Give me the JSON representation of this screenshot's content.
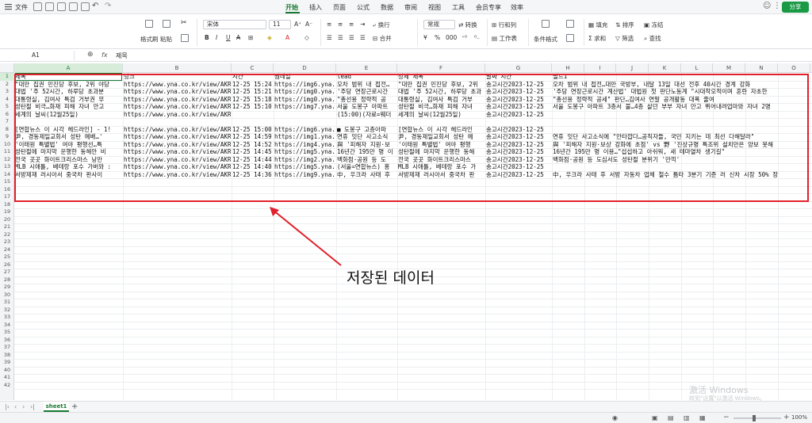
{
  "titlebar": {
    "file_menu": "文件",
    "tabs": [
      "开始",
      "插入",
      "页面",
      "公式",
      "数据",
      "审阅",
      "视图",
      "工具",
      "会员专享",
      "效率"
    ],
    "active_tab": "开始",
    "share_label": "分享"
  },
  "ribbon": {
    "format_painter": "格式刷",
    "paste": "粘贴",
    "font_name": "宋体",
    "font_size": "11",
    "number_format": "常规",
    "convert": "转换",
    "wrap": "换行",
    "merge": "合并",
    "rows_cols": "行和列",
    "worksheet": "工作表",
    "conditional_format": "条件格式",
    "fill": "填充",
    "sort": "排序",
    "freeze": "冻结",
    "sum": "求和",
    "filter": "筛选",
    "find": "查找"
  },
  "formula_bar": {
    "cell_ref": "A1",
    "fx": "fx",
    "value": "제목"
  },
  "columns": [
    "A",
    "B",
    "C",
    "D",
    "E",
    "F",
    "G",
    "H",
    "I",
    "J",
    "K",
    "L",
    "M",
    "N",
    "O"
  ],
  "rows": [
    {
      "n": "1",
      "cells": [
        "제목",
        "링크",
        "시간",
        "썸네일",
        "lead",
        "상세 제목",
        "날짜 시간",
        "필드1"
      ]
    },
    {
      "n": "2",
      "cells": [
        "\"대만 집권 민진당 후보, 2위 야당",
        "https://www.yna.co.kr/view/AKR2C",
        "12-25 15:24",
        "https://img6.yna.c",
        "오차 범위 내 접전…",
        "\"대만 집권 민진당 후보, 2위",
        "송고시간2023-12-25",
        "오차 범위 내 접전…대만 국방부, 내달 13일 대선 전후 40시간 경계 강화"
      ]
    },
    {
      "n": "3",
      "cells": [
        "대법 '주 52시간, 하루당 초과분",
        "https://www.yna.co.kr/view/AKR2C",
        "12-25 15:21",
        "https://img0.yna.c",
        "'주당 연장근로시간",
        "대법 '주 52시간, 하루당 초과",
        "송고시간2023-12-25",
        "'주당 연장근로시간 계산법' 대법원 첫 판단노동계 \"시대착오적이며 혼란 자초한"
      ]
    },
    {
      "n": "4",
      "cells": [
        "대통령실, 김여사 특검 거부권 무",
        "https://www.yna.co.kr/view/AKR2C",
        "12-25 15:18",
        "https://img0.yna.c",
        "\"총선용 정략적 공",
        "대통령실, 김여사 특검 거부",
        "송고시간2023-12-25",
        "\"총선용 정략적 공세\" 판단…김여사 연말 공개활동 대폭 줄여"
      ]
    },
    {
      "n": "5",
      "cells": [
        "성탄절 비극…화재 피해 자녀 안고",
        "https://www.yna.co.kr/view/AKR2C",
        "12-25 15:10",
        "https://img7.yna.c",
        "서울 도봉구 아파트",
        "성탄절 비극…화재 피해 자녀",
        "송고시간2023-12-25",
        "서울 도봉구 아파트 3층서 불…4층 살던 부부 자녀 안고 뛰어내려업마와 자녀 2명"
      ]
    },
    {
      "n": "6",
      "cells": [
        "세계의 날씨(12월25일)",
        "https://www.yna.co.kr/view/AKR2C",
        "",
        "",
        "(15:00)(자료=웨더",
        "세계의 날씨(12월25일)",
        "송고시간2023-12-25",
        ""
      ]
    },
    {
      "n": "7",
      "cells": [
        "",
        "",
        "",
        "",
        "",
        "",
        "",
        ""
      ]
    },
    {
      "n": "8",
      "cells": [
        "[연합뉴스 이 시각 헤드라인] - 1!",
        "https://www.yna.co.kr/view/AKR2C",
        "12-25 15:00",
        "https://img6.yna.c",
        "■ 도봉구 고층아파",
        "[연합뉴스 이 시각 헤드라인",
        "송고시간2023-12-25",
        ""
      ]
    },
    {
      "n": "9",
      "cells": [
        "尹, 경동제일교회서 성탄 예배…'",
        "https://www.yna.co.kr/view/AKR2C",
        "12-25 14:59",
        "https://img1.yna.c",
        "연휴 잇단 사고소식",
        "尹, 경동제일교회서 성탄 예",
        "송고시간2023-12-25",
        "연휴 잇단 사고소식에 \"안타깝다…공직자들, 국민 지키는 데 최선 다해달라\""
      ]
    },
    {
      "n": "10",
      "cells": [
        "'이태원 특별법' 여야 평행선…특",
        "https://www.yna.co.kr/view/AKR2C",
        "12-25 14:52",
        "https://img4.yna.c",
        "與 '피해자 지원·보",
        "'이태원 특별법' 여야 평행",
        "송고시간2023-12-25",
        "與 '피해자 지원·보상 강화에 초점' vs 野 '진상규명 특조위 설치만은 양보 못해"
      ]
    },
    {
      "n": "11",
      "cells": [
        "성탄절에 마지막 운행한 동해안 비",
        "https://www.yna.co.kr/view/AKR2C",
        "12-25 14:45",
        "https://img5.yna.c",
        "16년간 195만 명 이",
        "성탄절에 마지막 운행한 동해",
        "송고시간2023-12-25",
        "16년간 195만 명 이용…\"섭섭하고 아쉬워, 새 테마열차 생기길\""
      ]
    },
    {
      "n": "12",
      "cells": [
        "전국 곳곳 화이트크리스마스 낭만",
        "https://www.yna.co.kr/view/AKR2C",
        "12-25 14:44",
        "https://img2.yna.c",
        "백화점·공원 등 도",
        "전국 곳곳 화이트크리스마스",
        "송고시간2023-12-25",
        "백화점·공원 등 도심서도 성탄절 분위기 '만끽'"
      ]
    },
    {
      "n": "13",
      "cells": [
        "MLB 시애틀, 베테랑 포수 가버와 :",
        "https://www.yna.co.kr/view/AKR2C",
        "12-25 14:40",
        "https://img5.yna.c",
        "(서울=연합뉴스) 홍",
        "MLB 시애틀, 베테랑 포수 가",
        "송고시간2023-12-25",
        ""
      ]
    },
    {
      "n": "14",
      "cells": [
        "서방제재 러시아서 중국차 판사이",
        "https://www.yna.co.kr/view/AKR2C",
        "12-25 14:36",
        "https://img9.yna.c",
        "中, 우크라 사태 후",
        "서방제재 러시아서 중국차 판",
        "송고시간2023-12-25",
        "中, 우크라 사태 후 서방 자동차 업체 철수 틈타 3분기 기준 러 신차 시장 50% 장"
      ]
    },
    {
      "n": "15",
      "cells": [
        "",
        "",
        "",
        "",
        "",
        "",
        "",
        ""
      ]
    },
    {
      "n": "16",
      "cells": [
        "",
        "",
        "",
        "",
        "",
        "",
        "",
        ""
      ]
    },
    {
      "n": "17",
      "cells": [
        "",
        "",
        "",
        "",
        "",
        "",
        "",
        ""
      ]
    },
    {
      "n": "18",
      "cells": [
        "",
        "",
        "",
        "",
        "",
        "",
        "",
        ""
      ]
    },
    {
      "n": "19",
      "cells": [
        "",
        "",
        "",
        "",
        "",
        "",
        "",
        ""
      ]
    },
    {
      "n": "20",
      "cells": [
        "",
        "",
        "",
        "",
        "",
        "",
        "",
        ""
      ]
    },
    {
      "n": "21",
      "cells": [
        "",
        "",
        "",
        "",
        "",
        "",
        "",
        ""
      ]
    },
    {
      "n": "22",
      "cells": [
        "",
        "",
        "",
        "",
        "",
        "",
        "",
        ""
      ]
    },
    {
      "n": "23",
      "cells": [
        "",
        "",
        "",
        "",
        "",
        "",
        "",
        ""
      ]
    },
    {
      "n": "24",
      "cells": [
        "",
        "",
        "",
        "",
        "",
        "",
        "",
        ""
      ]
    },
    {
      "n": "25",
      "cells": [
        "",
        "",
        "",
        "",
        "",
        "",
        "",
        ""
      ]
    },
    {
      "n": "26",
      "cells": [
        "",
        "",
        "",
        "",
        "",
        "",
        "",
        ""
      ]
    },
    {
      "n": "27",
      "cells": [
        "",
        "",
        "",
        "",
        "",
        "",
        "",
        ""
      ]
    },
    {
      "n": "28",
      "cells": [
        "",
        "",
        "",
        "",
        "",
        "",
        "",
        ""
      ]
    },
    {
      "n": "29",
      "cells": [
        "",
        "",
        "",
        "",
        "",
        "",
        "",
        ""
      ]
    },
    {
      "n": "30",
      "cells": [
        "",
        "",
        "",
        "",
        "",
        "",
        "",
        ""
      ]
    },
    {
      "n": "31",
      "cells": [
        "",
        "",
        "",
        "",
        "",
        "",
        "",
        ""
      ]
    },
    {
      "n": "32",
      "cells": [
        "",
        "",
        "",
        "",
        "",
        "",
        "",
        ""
      ]
    },
    {
      "n": "33",
      "cells": [
        "",
        "",
        "",
        "",
        "",
        "",
        "",
        ""
      ]
    },
    {
      "n": "34",
      "cells": [
        "",
        "",
        "",
        "",
        "",
        "",
        "",
        ""
      ]
    },
    {
      "n": "35",
      "cells": [
        "",
        "",
        "",
        "",
        "",
        "",
        "",
        ""
      ]
    },
    {
      "n": "36",
      "cells": [
        "",
        "",
        "",
        "",
        "",
        "",
        "",
        ""
      ]
    },
    {
      "n": "37",
      "cells": [
        "",
        "",
        "",
        "",
        "",
        "",
        "",
        ""
      ]
    },
    {
      "n": "38",
      "cells": [
        "",
        "",
        "",
        "",
        "",
        "",
        "",
        ""
      ]
    },
    {
      "n": "39",
      "cells": [
        "",
        "",
        "",
        "",
        "",
        "",
        "",
        ""
      ]
    },
    {
      "n": "40",
      "cells": [
        "",
        "",
        "",
        "",
        "",
        "",
        "",
        ""
      ]
    },
    {
      "n": "41",
      "cells": [
        "",
        "",
        "",
        "",
        "",
        "",
        "",
        ""
      ]
    },
    {
      "n": "42",
      "cells": [
        "",
        "",
        "",
        "",
        "",
        "",
        "",
        ""
      ]
    }
  ],
  "annotation": "저장된 데이터",
  "watermark": {
    "line1": "激活 Windows",
    "line2": "转到\"设置\"以激活 Windows。"
  },
  "sheet_tab": "sheet1",
  "zoom": "100%",
  "colors": {
    "accent": "#1a7a33",
    "annotation_red": "#e0202a"
  }
}
